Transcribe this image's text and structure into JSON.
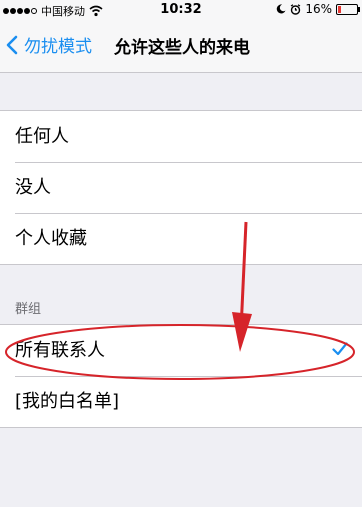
{
  "status_bar": {
    "carrier": "中国移动",
    "time": "10:32",
    "battery_percent": "16%",
    "battery_level": 0.16,
    "icons": [
      "signal-dots",
      "wifi-icon",
      "moon-icon",
      "alarm-icon",
      "battery-icon"
    ]
  },
  "nav": {
    "back_label": "勿扰模式",
    "title": "允许这些人的来电"
  },
  "options": {
    "items": [
      {
        "label": "任何人"
      },
      {
        "label": "没人"
      },
      {
        "label": "个人收藏"
      }
    ]
  },
  "groups": {
    "header": "群组",
    "items": [
      {
        "label": "所有联系人",
        "checked": true
      },
      {
        "label": "[我的白名单]",
        "checked": false
      }
    ]
  },
  "colors": {
    "accent": "#1a8ef0",
    "annotation_red": "#d6242a",
    "background": "#efeff4"
  }
}
